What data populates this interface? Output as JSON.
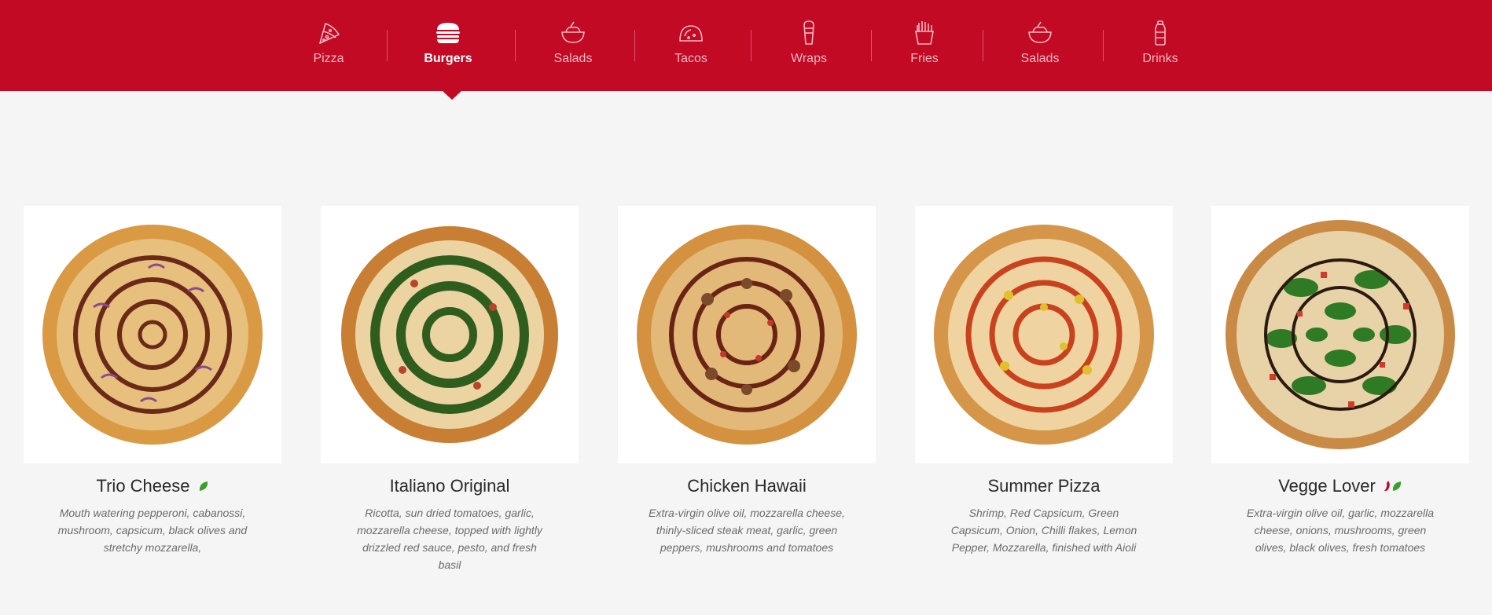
{
  "colors": {
    "brand": "#c20a25",
    "background": "#f5f5f5",
    "nav_inactive": "#f2b8c1",
    "nav_active": "#ffffff",
    "leaf": "#3aa02a",
    "chili": "#c20a25"
  },
  "nav": {
    "items": [
      {
        "label": "Pizza",
        "icon": "pizza-slice-icon"
      },
      {
        "label": "Burgers",
        "icon": "burger-icon",
        "active": true
      },
      {
        "label": "Salads",
        "icon": "salad-bowl-icon"
      },
      {
        "label": "Tacos",
        "icon": "taco-icon"
      },
      {
        "label": "Wraps",
        "icon": "wrap-icon"
      },
      {
        "label": "Fries",
        "icon": "fries-icon"
      },
      {
        "label": "Salads",
        "icon": "salad-bowl-icon"
      },
      {
        "label": "Drinks",
        "icon": "bottle-icon"
      }
    ]
  },
  "menu": {
    "items": [
      {
        "title": "Trio Cheese",
        "desc": "Mouth watering pepperoni, cabanossi, mushroom, capsicum, black olives and stretchy mozzarella,",
        "badges": [
          "vegetarian-leaf-icon"
        ]
      },
      {
        "title": "Italiano Original",
        "desc": "Ricotta, sun dried tomatoes, garlic, mozzarella cheese, topped with lightly drizzled red sauce, pesto, and fresh basil",
        "badges": []
      },
      {
        "title": "Chicken Hawaii",
        "desc": "Extra-virgin olive oil, mozzarella cheese, thinly-sliced steak meat, garlic, green peppers, mushrooms and tomatoes",
        "badges": []
      },
      {
        "title": "Summer Pizza",
        "desc": "Shrimp, Red Capsicum, Green Capsicum, Onion, Chilli flakes, Lemon Pepper, Mozzarella, finished with Aioli",
        "badges": []
      },
      {
        "title": "Vegge Lover",
        "desc": "Extra-virgin olive oil, garlic, mozzarella cheese, onions, mushrooms, green olives, black olives, fresh tomatoes",
        "badges": [
          "spicy-chili-icon",
          "vegetarian-leaf-icon"
        ]
      }
    ]
  }
}
